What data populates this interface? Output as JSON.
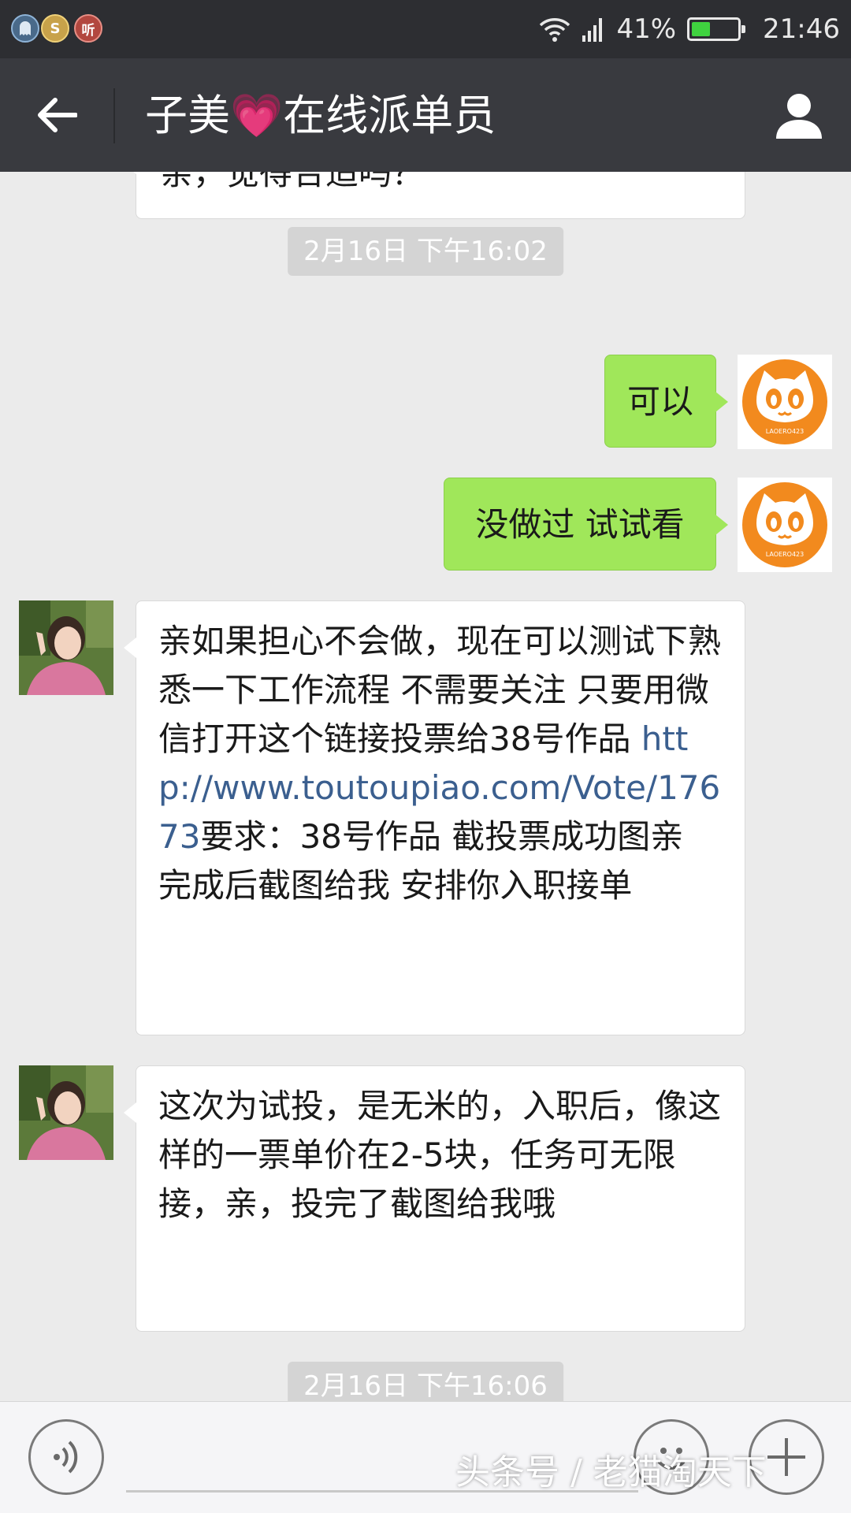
{
  "status_bar": {
    "app_icons": [
      "ghost-app-icon",
      "s-app-icon",
      "ting-app-icon"
    ],
    "ting_label": "听",
    "s_label": "S",
    "battery_percent_label": "41%",
    "battery_level": 0.41,
    "time": "21:46"
  },
  "header": {
    "title_prefix": "子美",
    "title_heart": "💗",
    "title_suffix": "在线派单员"
  },
  "chat": {
    "partial_message": "亲，觉得合适吗？",
    "timestamp_1": "2月16日 下午16:02",
    "msg_me_1": "可以",
    "msg_me_2": "没做过 试试看",
    "msg_them_1_text": "亲如果担心不会做，现在可以测试下熟悉一下工作流程  不需要关注 只要用微信打开这个链接投票给38号作品 ",
    "msg_them_1_link": "http://www.toutoupiao.com/Vote/17673",
    "msg_them_1_after": "要求：38号作品 截投票成功图亲 完成后截图给我 安排你入职接单",
    "msg_them_2": " 这次为试投，是无米的，入职后，像这样的一票单价在2-5块，任务可无限接，亲，投完了截图给我哦",
    "timestamp_2": "2月16日 下午16:06",
    "avatar_me_caption": "LAOERO423"
  },
  "watermark": "头条号 / 老猫淘天下",
  "colors": {
    "status_bar_bg": "#2d2e32",
    "title_bar_bg": "#393a3f",
    "chat_bg": "#ebebeb",
    "bubble_green": "#a0e75a",
    "bubble_white": "#ffffff",
    "link": "#3b5f8f",
    "avatar_orange": "#f28a1e"
  }
}
